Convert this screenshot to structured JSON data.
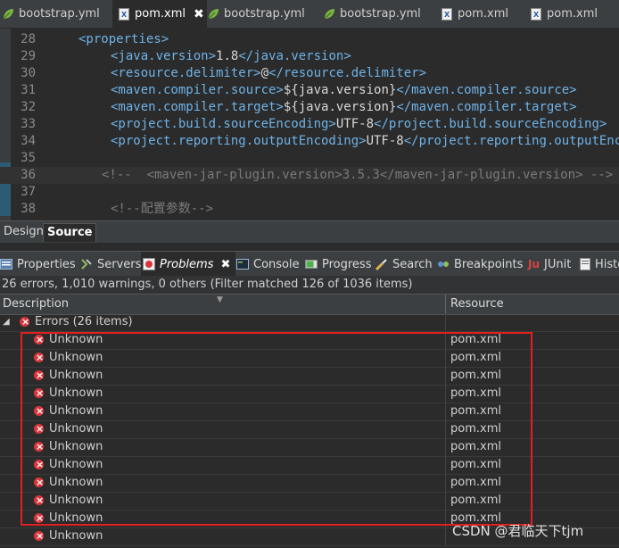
{
  "editor_tabs": [
    {
      "label": "bootstrap.yml",
      "icon": "spring-leaf-icon"
    },
    {
      "label": "pom.xml",
      "icon": "xml-file-icon",
      "active": true
    },
    {
      "label": "bootstrap.yml",
      "icon": "spring-leaf-icon"
    },
    {
      "label": "bootstrap.yml",
      "icon": "spring-leaf-icon"
    },
    {
      "label": "pom.xml",
      "icon": "xml-file-icon"
    },
    {
      "label": "pom.xml",
      "icon": "xml-file-icon"
    }
  ],
  "code_lines": [
    {
      "n": "28",
      "segments": [
        {
          "c": "t",
          "v": "<properties>"
        }
      ]
    },
    {
      "n": "29",
      "segments": [
        {
          "c": "t",
          "v": "<java.version>"
        },
        {
          "c": "tx",
          "v": "1.8"
        },
        {
          "c": "t",
          "v": "</java.version>"
        }
      ]
    },
    {
      "n": "30",
      "segments": [
        {
          "c": "t",
          "v": "<resource.delimiter>"
        },
        {
          "c": "tx",
          "v": "@"
        },
        {
          "c": "t",
          "v": "</resource.delimiter>"
        }
      ]
    },
    {
      "n": "31",
      "segments": [
        {
          "c": "t",
          "v": "<maven.compiler.source>"
        },
        {
          "c": "tx",
          "v": "${java.version}"
        },
        {
          "c": "t",
          "v": "</maven.compiler.source>"
        }
      ]
    },
    {
      "n": "32",
      "segments": [
        {
          "c": "t",
          "v": "<maven.compiler.target>"
        },
        {
          "c": "tx",
          "v": "${java.version}"
        },
        {
          "c": "t",
          "v": "</maven.compiler.target>"
        }
      ]
    },
    {
      "n": "33",
      "segments": [
        {
          "c": "t",
          "v": "<project.build.sourceEncoding>"
        },
        {
          "c": "tx",
          "v": "UTF-8"
        },
        {
          "c": "t",
          "v": "</project.build.sourceEncoding>"
        }
      ]
    },
    {
      "n": "34",
      "segments": [
        {
          "c": "t",
          "v": "<project.reporting.outputEncoding>"
        },
        {
          "c": "tx",
          "v": "UTF-8"
        },
        {
          "c": "t",
          "v": "</project.reporting.outputEncoding>"
        }
      ]
    },
    {
      "n": "35",
      "segments": []
    },
    {
      "n": "36",
      "segments": [
        {
          "c": "cm",
          "v": "<!--  <maven-jar-plugin.version>3.5.3</maven-jar-plugin.version> -->"
        }
      ]
    },
    {
      "n": "37",
      "segments": []
    },
    {
      "n": "38",
      "segments": [
        {
          "c": "cm",
          "v": "<!--配置参数-->"
        }
      ]
    }
  ],
  "mode_tabs": {
    "design": "Design",
    "source": "Source"
  },
  "view_tabs": [
    {
      "label": "Properties",
      "icon": "properties-icon"
    },
    {
      "label": "Servers",
      "icon": "servers-icon"
    },
    {
      "label": "Problems",
      "icon": "problems-icon",
      "active": true
    },
    {
      "label": "Console",
      "icon": "console-icon"
    },
    {
      "label": "Progress",
      "icon": "progress-icon"
    },
    {
      "label": "Search",
      "icon": "search-icon"
    },
    {
      "label": "Breakpoints",
      "icon": "breakpoints-icon"
    },
    {
      "label": "JUnit",
      "icon": "junit-icon"
    },
    {
      "label": "History",
      "icon": "history-icon"
    }
  ],
  "problems": {
    "summary": "26 errors, 1,010 warnings, 0 others (Filter matched 126 of 1036 items)",
    "columns": {
      "description": "Description",
      "resource": "Resource"
    },
    "group_label": "Errors (26 items)",
    "items": [
      {
        "description": "Unknown",
        "resource": "pom.xml"
      },
      {
        "description": "Unknown",
        "resource": "pom.xml"
      },
      {
        "description": "Unknown",
        "resource": "pom.xml"
      },
      {
        "description": "Unknown",
        "resource": "pom.xml"
      },
      {
        "description": "Unknown",
        "resource": "pom.xml"
      },
      {
        "description": "Unknown",
        "resource": "pom.xml"
      },
      {
        "description": "Unknown",
        "resource": "pom.xml"
      },
      {
        "description": "Unknown",
        "resource": "pom.xml"
      },
      {
        "description": "Unknown",
        "resource": "pom.xml"
      },
      {
        "description": "Unknown",
        "resource": "pom.xml"
      },
      {
        "description": "Unknown",
        "resource": "pom.xml"
      },
      {
        "description": "Unknown",
        "resource": ""
      }
    ]
  },
  "watermark": "CSDN @君临天下tjm",
  "colors": {
    "tag": "#6fb3e8",
    "comment": "#7b7b7b",
    "error": "#d8363c",
    "highlight_box": "#e02020"
  }
}
